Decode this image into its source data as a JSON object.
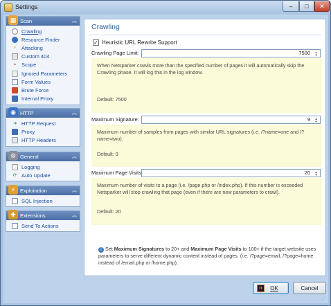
{
  "window": {
    "title": "Settings",
    "minimize_glyph": "–",
    "maximize_glyph": "□",
    "close_glyph": "✕"
  },
  "sidebar": {
    "groups": [
      {
        "label": "Scan",
        "icon": "scan-icon",
        "items": [
          {
            "label": "Crawling",
            "icon": "crawling-icon",
            "selected": true
          },
          {
            "label": "Resource Finder",
            "icon": "resource-finder-icon"
          },
          {
            "label": "Attacking",
            "icon": "attacking-icon"
          },
          {
            "label": "Custom 404",
            "icon": "custom-404-icon"
          },
          {
            "label": "Scope",
            "icon": "scope-icon"
          },
          {
            "label": "Ignored Parameters",
            "icon": "ignored-parameters-icon"
          },
          {
            "label": "Form Values",
            "icon": "form-values-icon"
          },
          {
            "label": "Brute Force",
            "icon": "brute-force-icon"
          },
          {
            "label": "Internal Proxy",
            "icon": "internal-proxy-icon"
          }
        ]
      },
      {
        "label": "HTTP",
        "icon": "http-icon",
        "items": [
          {
            "label": "HTTP Request",
            "icon": "http-request-icon"
          },
          {
            "label": "Proxy",
            "icon": "proxy-icon"
          },
          {
            "label": "HTTP Headers",
            "icon": "http-headers-icon"
          }
        ]
      },
      {
        "label": "General",
        "icon": "general-icon",
        "items": [
          {
            "label": "Logging",
            "icon": "logging-icon"
          },
          {
            "label": "Auto Update",
            "icon": "auto-update-icon"
          }
        ]
      },
      {
        "label": "Exploitation",
        "icon": "exploitation-icon",
        "items": [
          {
            "label": "SQL Injection",
            "icon": "sql-injection-icon"
          }
        ]
      },
      {
        "label": "Extensions",
        "icon": "extensions-icon",
        "items": [
          {
            "label": "Send To Actions",
            "icon": "send-to-actions-icon"
          }
        ]
      }
    ]
  },
  "main": {
    "title": "Crawling",
    "heuristic": {
      "label": "Heuristic URL Rewrite Support",
      "checked": true
    },
    "fields": [
      {
        "label": "Crawling Page Limit:",
        "value": "7500",
        "help": "When Netsparker crawls more than the specified number of pages it will automatically skip the Crawling phase. It will log this in the log window.",
        "default": "Default: 7500"
      },
      {
        "label": "Maximum Signature:",
        "value": "9",
        "help": "Maximum number of samples from pages with similar URL signatures (i.e. /?name=one and /?name=two).",
        "default": "Default: 9"
      },
      {
        "label": "Maximum Page Visits:",
        "value": "20",
        "help": "Maximum number of visits to a page (i.e. /page.php or /index.php). If this number is exceeded Netsparker will stop crawling that page (even if there are new parameters to crawl).",
        "default": "Default: 20"
      }
    ],
    "tip": {
      "prefix": "Set ",
      "bold1": "Maximum Signatures",
      "mid": " to 20+ and ",
      "bold2": "Maximum Page Visits",
      "suffix": " to 100+ if the target website uses parameters to serve different dynamic content instead of pages. (i.e. /?page=email, /?page=home instead of /email.php or /home.php)."
    }
  },
  "buttons": {
    "ok_label": "OK",
    "cancel_label": "Cancel"
  },
  "colors": {
    "accent": "#2c5d98",
    "help_background": "#fbfbd9",
    "group_header": "#4b6ea6"
  }
}
